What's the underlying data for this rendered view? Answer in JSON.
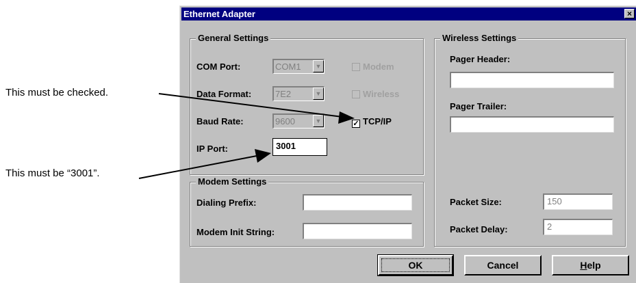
{
  "annotations": {
    "checked_note": "This must be checked.",
    "port_note": "This must be “3001”."
  },
  "dialog": {
    "title": "Ethernet Adapter",
    "close_glyph": "×"
  },
  "general": {
    "legend": "General Settings",
    "com_port_label": "COM Port:",
    "com_port_value": "COM1",
    "data_format_label": "Data Format:",
    "data_format_value": "7E2",
    "baud_rate_label": "Baud Rate:",
    "baud_rate_value": "9600",
    "ip_port_label": "IP Port:",
    "ip_port_value": "3001",
    "modem_check": "Modem",
    "wireless_check": "Wireless",
    "tcpip_check": "TCP/IP",
    "tcpip_mark": "✓"
  },
  "modem": {
    "legend": "Modem Settings",
    "dialing_prefix_label": "Dialing Prefix:",
    "dialing_prefix_value": "",
    "init_string_label": "Modem Init String:",
    "init_string_value": ""
  },
  "wireless": {
    "legend": "Wireless Settings",
    "pager_header_label": "Pager Header:",
    "pager_header_value": "",
    "pager_trailer_label": "Pager Trailer:",
    "pager_trailer_value": "",
    "packet_size_label": "Packet Size:",
    "packet_size_value": "150",
    "packet_delay_label": "Packet Delay:",
    "packet_delay_value": "2"
  },
  "buttons": {
    "ok": "OK",
    "cancel": "Cancel",
    "help_accel": "H",
    "help_rest": "elp"
  }
}
